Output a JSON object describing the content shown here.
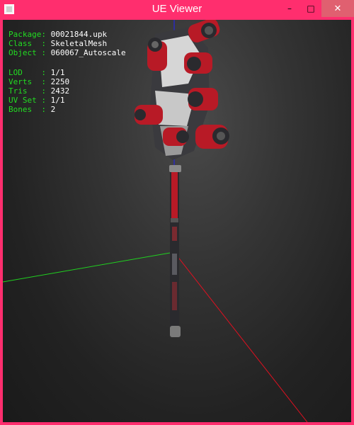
{
  "window": {
    "title": "UE Viewer",
    "accent": "#ff2e6e",
    "controls": {
      "minimize": "–",
      "maximize": "□",
      "close": "✕"
    }
  },
  "info": {
    "package_key": "Package:",
    "package": "00021844.upk",
    "class_key": "Class  :",
    "class": "SkeletalMesh",
    "object_key": "Object :",
    "object": "060067_Autoscale",
    "lod_key": "LOD    :",
    "lod": "1/1",
    "verts_key": "Verts  :",
    "verts": "2250",
    "tris_key": "Tris   :",
    "tris": "2432",
    "uvset_key": "UV Set :",
    "uvset": "1/1",
    "bones_key": "Bones  :",
    "bones": "2"
  },
  "colors": {
    "label_text": "#22dd22",
    "value_text": "#ffffff",
    "axis_x": "#e01020",
    "axis_y": "#20d020",
    "axis_z": "#2020ff",
    "mesh_red": "#b81a26",
    "mesh_dark": "#2a2a2e"
  }
}
